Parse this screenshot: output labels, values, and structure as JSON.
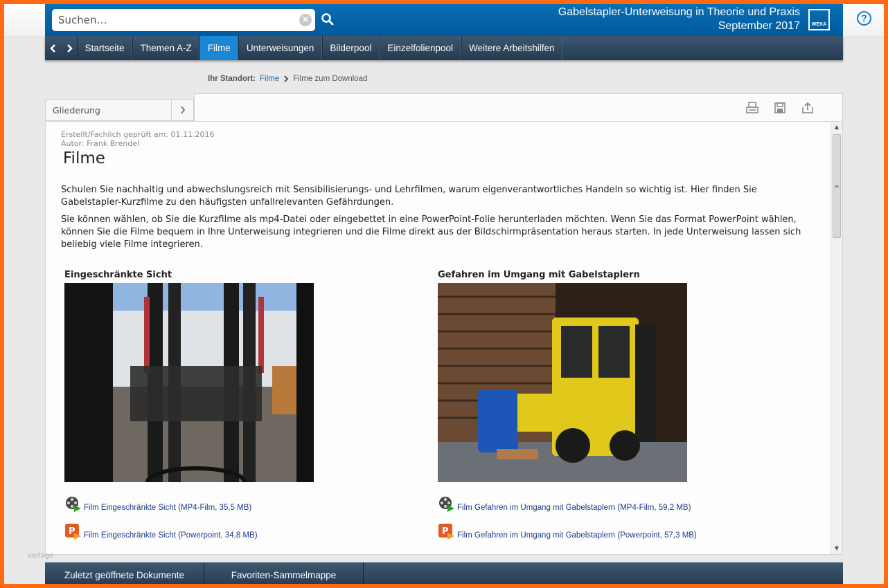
{
  "search": {
    "placeholder": "Suchen…"
  },
  "header": {
    "title_line1": "Gabelstapler-Unterweisung in Theorie und Praxis",
    "title_line2": "September 2017",
    "logo_text": "WEKA",
    "help_label": "?"
  },
  "nav": {
    "items": [
      {
        "label": "Startseite",
        "active": false
      },
      {
        "label": "Themen A-Z",
        "active": false
      },
      {
        "label": "Filme",
        "active": true
      },
      {
        "label": "Unterweisungen",
        "active": false
      },
      {
        "label": "Bilderpool",
        "active": false
      },
      {
        "label": "Einzelfolienpool",
        "active": false
      },
      {
        "label": "Weitere Arbeitshilfen",
        "active": false
      }
    ]
  },
  "breadcrumb": {
    "label": "Ihr Standort:",
    "link": "Filme",
    "current": "Filme zum Download"
  },
  "outline": {
    "label": "Gliederung"
  },
  "article": {
    "meta_created": "Erstellt/Fachlich geprüft am: 01.11.2016",
    "meta_author": "Autor: Frank Brendel",
    "title": "Filme",
    "para1": "Schulen Sie nachhaltig und abwechslungsreich mit Sensibilisierungs- und Lehrfilmen, warum eigenverantwortliches Handeln so wichtig ist. Hier finden Sie Gabelstapler-Kurzfilme zu den häufigsten unfallrelevanten Gefährdungen.",
    "para2": "Sie können wählen, ob Sie die Kurzfilme als mp4-Datei oder eingebettet in eine PowerPoint-Folie herunterladen möchten. Wenn Sie das Format PowerPoint wählen, können Sie die Filme bequem in Ihre Unterweisung integrieren und die Filme direkt aus der Bildschirmpräsentation heraus starten. In jede Unterweisung lassen sich beliebig viele Filme integrieren."
  },
  "films": [
    {
      "heading": "Eingeschränkte Sicht",
      "mp4_link": "Film Eingeschränkte Sicht (MP4-Film, 35,5 MB)",
      "ppt_link": "Film Eingeschränkte Sicht (Powerpoint, 34,8 MB)"
    },
    {
      "heading": "Gefahren im Umgang mit Gabelstaplern",
      "mp4_link": "Film Gefahren im Umgang mit Gabelstaplern (MP4-Film, 59,2 MB)",
      "ppt_link": "Film Gefahren im Umgang mit Gabelstaplern (Powerpoint, 57,3 MB)"
    }
  ],
  "watermark": "vorlage",
  "bottom_tabs": [
    {
      "label": "Zuletzt geöffnete Dokumente"
    },
    {
      "label": "Favoriten-Sammelmappe"
    }
  ]
}
